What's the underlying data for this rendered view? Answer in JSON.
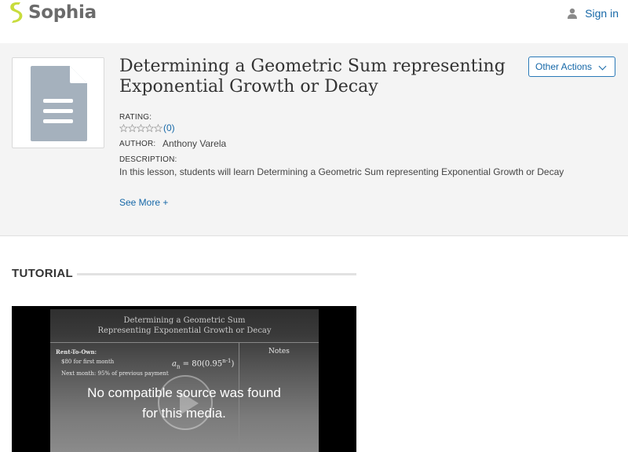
{
  "header": {
    "logo_text": "Sophia",
    "signin_label": "Sign in"
  },
  "lesson": {
    "title": "Determining a Geometric Sum representing Exponential Growth or Decay",
    "other_actions_label": "Other Actions",
    "rating_label": "RATING:",
    "rating_stars": 0,
    "rating_count": "(0)",
    "author_label": "AUTHOR:",
    "author_name": "Anthony Varela",
    "description_label": "DESCRIPTION:",
    "description": "In this lesson, students will learn Determining a Geometric Sum representing Exponential Growth or Decay",
    "see_more_label": "See More +"
  },
  "tutorial": {
    "heading": "TUTORIAL",
    "slide": {
      "title_line1": "Determining a Geometric Sum",
      "title_line2": "Representing Exponential Growth or Decay",
      "rent_label": "Rent-To-Own:",
      "first_month": "$80 for first month",
      "next_month": "Next month: 95% of previous payment",
      "formula_base": "a",
      "formula_sub": "n",
      "formula_body": " = 80(0.95",
      "formula_sup": "n-1",
      "formula_close": ")",
      "notes_label": "Notes"
    },
    "error_line1": "No compatible source was found",
    "error_line2": "for this media."
  },
  "colors": {
    "brand_blue": "#1668a8",
    "logo_green": "#c8dc3c",
    "hero_bg": "#f4f4f4"
  }
}
